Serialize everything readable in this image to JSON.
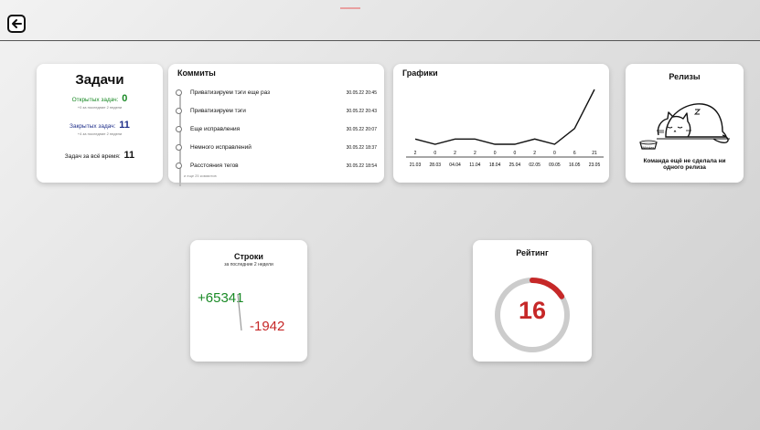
{
  "tasks": {
    "title": "Задачи",
    "open_label": "Открытых задач:",
    "open_count": "0",
    "open_sub": "+0 за последние 2 недели",
    "closed_label": "Закрытых задач:",
    "closed_count": "11",
    "closed_sub": "+4 за последние 2 недели",
    "all_label": "Задач за всё время:",
    "all_count": "11"
  },
  "commits": {
    "title": "Коммиты",
    "items": [
      {
        "message": "Приватизируем тэги еще раз",
        "date": "30.05.22 20:45"
      },
      {
        "message": "Приватизируем тэги",
        "date": "30.05.22 20:43"
      },
      {
        "message": "Еще исправления",
        "date": "30.05.22 20:07"
      },
      {
        "message": "Немного исправлений",
        "date": "30.05.22 18:37"
      },
      {
        "message": "Расстояния тегов",
        "date": "30.05.22 18:54"
      }
    ],
    "more": "и еще 25 коммитов"
  },
  "graphs": {
    "title": "Графики"
  },
  "chart_data": {
    "type": "line",
    "categories": [
      "21.03",
      "28.03",
      "04.04",
      "11.04",
      "18.04",
      "25.04",
      "02.05",
      "09.05",
      "16.05",
      "23.05"
    ],
    "values": [
      2,
      0,
      2,
      2,
      0,
      0,
      2,
      0,
      6,
      21
    ],
    "grid": false,
    "legend": "none"
  },
  "releases": {
    "title": "Релизы",
    "message": "Команда ещё не сделала ни одного релиза",
    "bowl_text": "Whiskas"
  },
  "lines": {
    "title": "Строки",
    "subtitle": "за последние 2 недели",
    "added": "+65341",
    "removed": "-1942"
  },
  "rating": {
    "title": "Рейтинг",
    "value": "16",
    "fraction": 0.16
  },
  "colors": {
    "green": "#1a8a26",
    "red": "#c62828",
    "blue": "#1f2f8a",
    "ring_track": "#cccccc"
  },
  "icons": {
    "back": "back-arrow-icon",
    "releases": "sleeping-cat-icon"
  }
}
